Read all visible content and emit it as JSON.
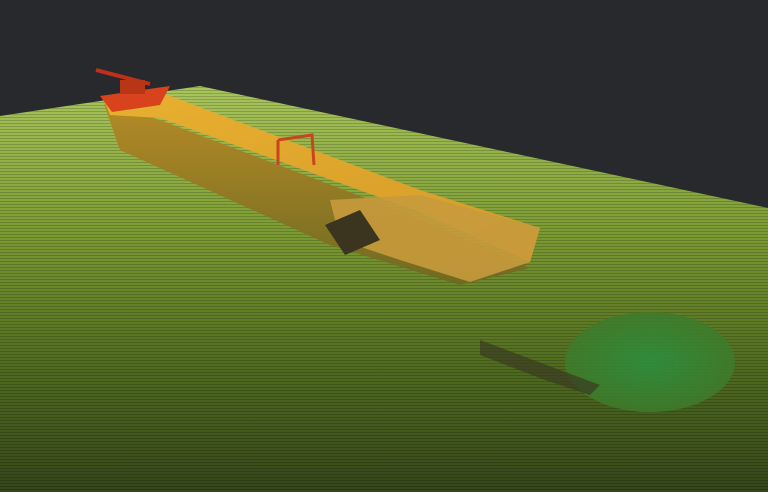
{
  "scene": {
    "subject": "shipwreck-point-cloud",
    "colors": {
      "background": "#27292c",
      "seabed_far": "#a6c45a",
      "seabed_mid": "#6f8f2e",
      "seabed_near": "#3a4d18",
      "hull_deck": "#e0a62a",
      "hull_side": "#9c7a22",
      "bow_structure": "#d8421c",
      "scour_pit": "#2f8a3a"
    }
  }
}
